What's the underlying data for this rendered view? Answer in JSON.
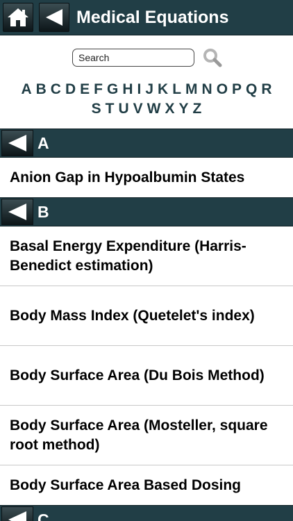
{
  "header": {
    "title": "Medical Equations",
    "home_icon": "home-icon",
    "back_icon": "back-arrow-icon"
  },
  "search": {
    "placeholder": "Search"
  },
  "alphabet": {
    "row1": [
      "A",
      "B",
      "C",
      "D",
      "E",
      "F",
      "G",
      "H",
      "I",
      "J",
      "K",
      "L",
      "M",
      "N",
      "O",
      "P",
      "Q",
      "R"
    ],
    "row2": [
      "S",
      "T",
      "U",
      "V",
      "W",
      "X",
      "Y",
      "Z"
    ]
  },
  "sections": [
    {
      "letter": "A",
      "items": [
        "Anion Gap in Hypoalbumin States"
      ]
    },
    {
      "letter": "B",
      "items": [
        "Basal Energy Expenditure (Harris-Benedict estimation)",
        "Body Mass Index (Quetelet's index)",
        "Body Surface Area (Du Bois Method)",
        "Body Surface Area (Mosteller, square root method)",
        "Body Surface Area Based Dosing"
      ]
    },
    {
      "letter": "C",
      "items": []
    }
  ],
  "colors": {
    "header_bg": "#213e46",
    "accent_text": "#213e46"
  }
}
